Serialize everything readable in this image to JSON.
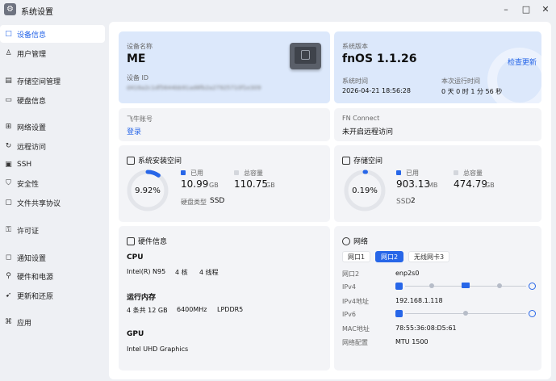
{
  "app": {
    "title": "系统设置"
  },
  "window": {
    "min": "–",
    "max": "□",
    "close": "✕"
  },
  "sidebar": {
    "items": [
      {
        "label": "设备信息",
        "icon": "□"
      },
      {
        "label": "用户管理",
        "icon": "♙"
      },
      {
        "label": "存储空间管理",
        "icon": "▤"
      },
      {
        "label": "硬盘信息",
        "icon": "▭"
      },
      {
        "label": "网络设置",
        "icon": "⊞"
      },
      {
        "label": "远程访问",
        "icon": "↻"
      },
      {
        "label": "SSH",
        "icon": "▣"
      },
      {
        "label": "安全性",
        "icon": "⛉"
      },
      {
        "label": "文件共享协议",
        "icon": "▢"
      },
      {
        "label": "许可证",
        "icon": "⚿"
      },
      {
        "label": "通知设置",
        "icon": "◻"
      },
      {
        "label": "硬件和电源",
        "icon": "⚲"
      },
      {
        "label": "更新和还原",
        "icon": "➹"
      },
      {
        "label": "应用",
        "icon": "⌘"
      }
    ]
  },
  "device": {
    "name_label": "设备名称",
    "name": "ME",
    "id_label": "设备 ID",
    "id_value": "d416a2c1df5644bb91ad8fb2a27925710f1e309"
  },
  "system": {
    "version_label": "系统版本",
    "version": "fnOS  1.1.26",
    "check_update": "检查更新",
    "time_label": "系统时间",
    "time_value": "2026-04-21 18:56:28",
    "uptime_label": "本次运行时间",
    "uptime_value": "0 天 0 时 1 分 56 秒"
  },
  "account": {
    "label": "飞牛账号",
    "login": "登录"
  },
  "fnconnect": {
    "label": "FN Connect",
    "status": "未开启远程访问"
  },
  "sys_space": {
    "title": "系统安装空间",
    "percent": "9.92%",
    "used_label": "已用",
    "used_value": "10.99",
    "used_unit": "GB",
    "total_label": "总容量",
    "total_value": "110.75",
    "total_unit": "GB",
    "disk_type_label": "硬盘类型",
    "disk_type": "SSD",
    "fraction": 0.0992
  },
  "storage": {
    "title": "存储空间",
    "percent": "0.19%",
    "used_label": "已用",
    "used_value": "903.13",
    "used_unit": "MB",
    "total_label": "总容量",
    "total_value": "474.79",
    "total_unit": "GB",
    "ssd_label": "SSD",
    "ssd_count": "2",
    "fraction": 0.0019
  },
  "hardware": {
    "title": "硬件信息",
    "cpu_title": "CPU",
    "cpu_model": "Intel(R) N95",
    "cpu_cores": "4 核",
    "cpu_threads": "4 线程",
    "mem_title": "运行内存",
    "mem_size": "4 条共 12 GB",
    "mem_freq": "6400MHz",
    "mem_type": "LPDDR5",
    "gpu_title": "GPU",
    "gpu_model": "Intel UHD Graphics"
  },
  "network": {
    "title": "网络",
    "tabs": [
      "网口1",
      "网口2",
      "无线网卡3"
    ],
    "active_tab": 1,
    "port_label": "网口2",
    "port_value": "enp2s0",
    "ipv4_label": "IPv4",
    "ipv4_addr_label": "IPv4地址",
    "ipv4_addr": "192.168.1.118",
    "ipv6_label": "IPv6",
    "mac_label": "MAC地址",
    "mac": "78:55:36:08:D5:61",
    "config_label": "网络配置",
    "mtu": "MTU 1500"
  },
  "colors": {
    "accent": "#2766e8",
    "track": "#e3e5ea"
  }
}
